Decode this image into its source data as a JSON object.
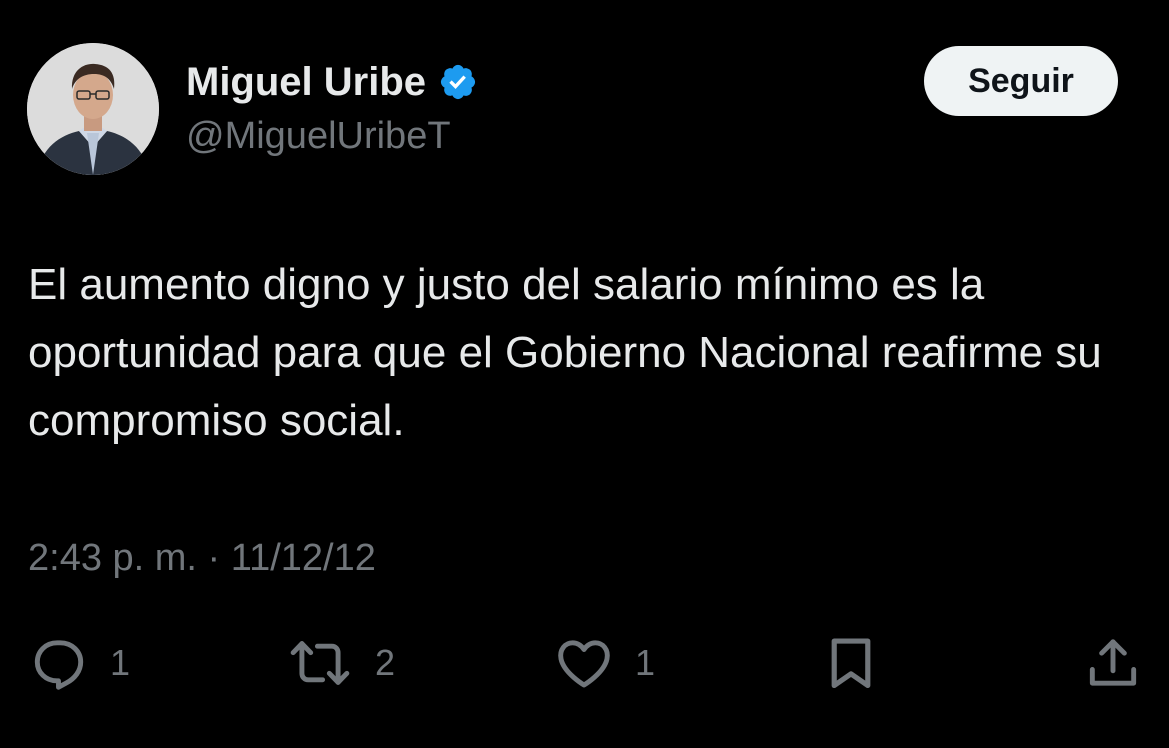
{
  "author": {
    "name": "Miguel Uribe",
    "handle": "@MiguelUribeT",
    "verified": true
  },
  "follow_button": {
    "label": "Seguir"
  },
  "tweet": {
    "text": "El aumento digno y justo del salario mínimo es la oportunidad para que el Gobierno Nacional reafirme su compromiso social.",
    "time": "2:43 p. m.",
    "separator": "·",
    "date": "11/12/12"
  },
  "actions": {
    "replies": "1",
    "retweets": "2",
    "likes": "1"
  },
  "icons": {
    "reply": "reply-icon",
    "retweet": "retweet-icon",
    "like": "heart-icon",
    "bookmark": "bookmark-icon",
    "share": "share-icon",
    "verified": "verified-badge-icon"
  },
  "colors": {
    "background": "#000000",
    "text_primary": "#e7e9ea",
    "text_secondary": "#71767b",
    "verified_blue": "#1d9bf0",
    "button_bg": "#eff3f4"
  }
}
